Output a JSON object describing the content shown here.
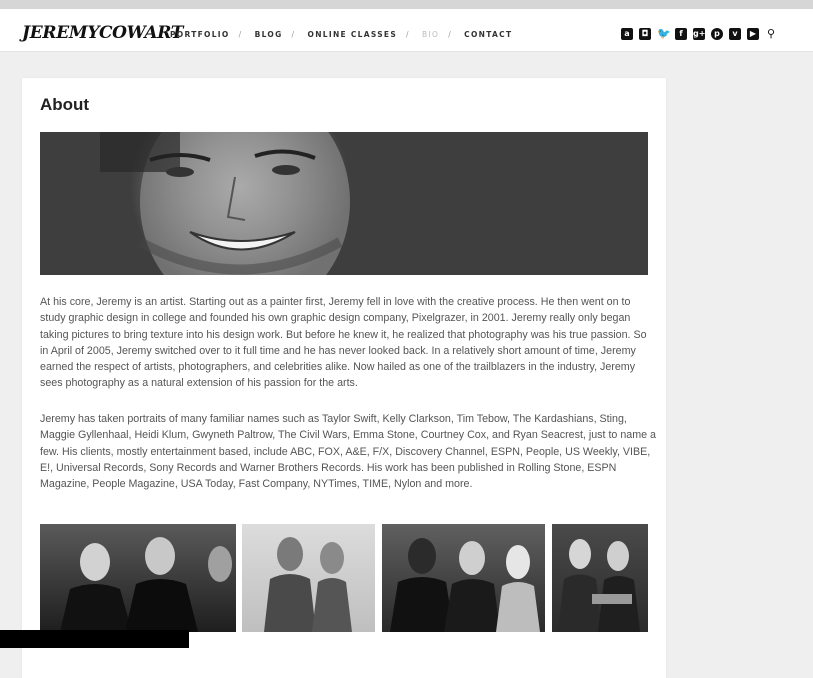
{
  "header": {
    "logo": "JEREMYCOWART",
    "nav": [
      {
        "label": "PORTFOLIO",
        "active": false
      },
      {
        "label": "BLOG",
        "active": false
      },
      {
        "label": "ONLINE CLASSES",
        "active": false
      },
      {
        "label": "BIO",
        "active": true
      },
      {
        "label": "CONTACT",
        "active": false
      }
    ],
    "separator": "/",
    "social": [
      {
        "name": "amazon-icon",
        "glyph": "a",
        "shape": "square"
      },
      {
        "name": "instagram-icon",
        "glyph": "◘",
        "shape": "square"
      },
      {
        "name": "twitter-icon",
        "glyph": "🐦",
        "shape": "plain"
      },
      {
        "name": "facebook-icon",
        "glyph": "f",
        "shape": "square"
      },
      {
        "name": "google-plus-icon",
        "glyph": "g+",
        "shape": "square"
      },
      {
        "name": "pinterest-icon",
        "glyph": "p",
        "shape": "round"
      },
      {
        "name": "vimeo-icon",
        "glyph": "v",
        "shape": "square"
      },
      {
        "name": "youtube-icon",
        "glyph": "▶",
        "shape": "square"
      },
      {
        "name": "location-pin-icon",
        "glyph": "⚲",
        "shape": "plain"
      }
    ]
  },
  "content": {
    "title": "About",
    "paragraph1": "At his core, Jeremy is an artist. Starting out as a painter first, Jeremy fell in love with the creative process. He then went on to study graphic design in college and founded his own graphic design company, Pixelgrazer, in 2001. Jeremy really only began taking pictures to bring texture into his design work. But before he knew it, he realized that photography was his true passion. So in April of 2005, Jeremy switched over to it full time and he has never looked back. In a relatively short amount of time, Jeremy earned the respect of artists, photographers, and celebrities alike. Now hailed as one of the trailblazers in the industry, Jeremy sees photography as a natural extension of his passion for the arts.",
    "paragraph2": "Jeremy has taken portraits of many familiar names such as Taylor Swift, Kelly Clarkson, Tim Tebow, The Kardashians, Sting, Maggie Gyllenhaal, Heidi Klum, Gwyneth Paltrow, The Civil Wars, Emma Stone, Courtney Cox, and Ryan Seacrest, just to name a few. His clients, mostly entertainment based, include ABC, FOX, A&E, F/X, Discovery Channel, ESPN, People, US Weekly, VIBE, E!, Universal Records, Sony Records and Warner Brothers Records. His work has been published in Rolling Stone, ESPN Magazine, People Magazine, USA Today, Fast Company, NYTimes, TIME, Nylon and more."
  },
  "colors": {
    "page_background": "#efefef",
    "card_background": "#ffffff",
    "nav_active": "#bbbbbb",
    "text": "#555555"
  }
}
